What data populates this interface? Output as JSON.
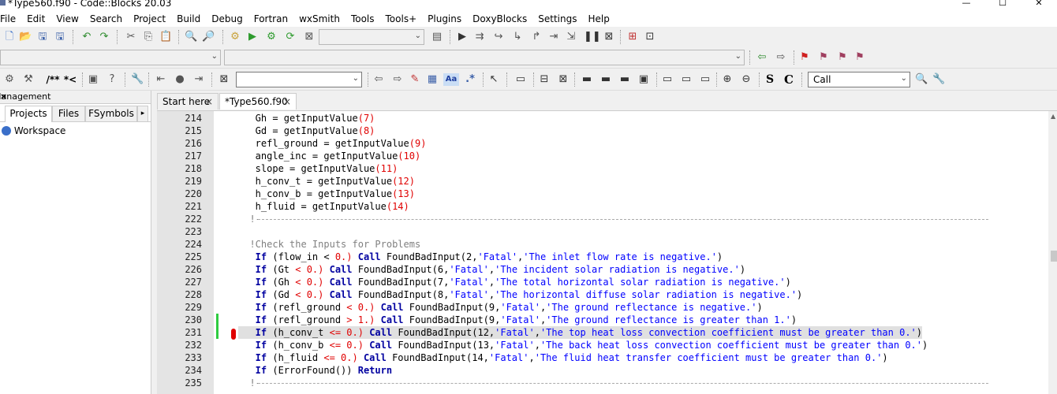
{
  "window": {
    "title": "*Type560.f90 - Code::Blocks 20.03"
  },
  "menu": [
    "File",
    "Edit",
    "View",
    "Search",
    "Project",
    "Build",
    "Debug",
    "Fortran",
    "wxSmith",
    "Tools",
    "Tools+",
    "Plugins",
    "DoxyBlocks",
    "Settings",
    "Help"
  ],
  "toolbar": {
    "build_target_value": "",
    "search_combo_value": "",
    "call_combo_value": "Call",
    "comment_labels": [
      "/**",
      "*<"
    ],
    "regex_label": ".*",
    "match_case_label": "Aa",
    "s_label": "S",
    "c_label": "C"
  },
  "management": {
    "title": "Management",
    "tabs": [
      "Projects",
      "Files",
      "FSymbols"
    ],
    "tree": [
      "Workspace"
    ]
  },
  "editor": {
    "tabs": [
      {
        "label": "Start here"
      },
      {
        "label": "*Type560.f90"
      }
    ],
    "lines": [
      {
        "n": "214",
        "code": [
          [
            "   Gh = getInputValue",
            ""
          ],
          [
            "(7)",
            "num-t"
          ]
        ]
      },
      {
        "n": "215",
        "code": [
          [
            "   Gd = getInputValue",
            ""
          ],
          [
            "(8)",
            "num-t"
          ]
        ]
      },
      {
        "n": "216",
        "code": [
          [
            "   refl_ground = getInputValue",
            ""
          ],
          [
            "(9)",
            "num-t"
          ]
        ]
      },
      {
        "n": "217",
        "code": [
          [
            "   angle_inc = getInputValue",
            ""
          ],
          [
            "(10)",
            "num-t"
          ]
        ]
      },
      {
        "n": "218",
        "code": [
          [
            "   slope = getInputValue",
            ""
          ],
          [
            "(11)",
            "num-t"
          ]
        ]
      },
      {
        "n": "219",
        "code": [
          [
            "   h_conv_t = getInputValue",
            ""
          ],
          [
            "(12)",
            "num-t"
          ]
        ]
      },
      {
        "n": "220",
        "code": [
          [
            "   h_conv_b = getInputValue",
            ""
          ],
          [
            "(13)",
            "num-t"
          ]
        ]
      },
      {
        "n": "221",
        "code": [
          [
            "   h_fluid = getInputValue",
            ""
          ],
          [
            "(14)",
            "num-t"
          ]
        ]
      },
      {
        "n": "222",
        "rule": true,
        "code": [
          [
            "  !-",
            "cm"
          ]
        ]
      },
      {
        "n": "223",
        "code": []
      },
      {
        "n": "224",
        "code": [
          [
            "  !Check the Inputs for Problems",
            "cm"
          ]
        ]
      },
      {
        "n": "225",
        "code": [
          [
            "   If",
            "kw"
          ],
          [
            " (flow_in ",
            ""
          ],
          [
            "<",
            ""
          ],
          [
            " 0.)",
            "num-t"
          ],
          [
            " Call",
            "kw"
          ],
          [
            " FoundBadInput(2,",
            ""
          ],
          [
            "'Fatal'",
            "str"
          ],
          [
            ",",
            ""
          ],
          [
            "'The inlet flow rate is negative.'",
            "str"
          ],
          [
            ")",
            ""
          ]
        ]
      },
      {
        "n": "226",
        "code": [
          [
            "   If",
            "kw"
          ],
          [
            " (Gt ",
            ""
          ],
          [
            "< 0.)",
            "num-t"
          ],
          [
            " Call",
            "kw"
          ],
          [
            " FoundBadInput(6,",
            ""
          ],
          [
            "'Fatal'",
            "str"
          ],
          [
            ",",
            ""
          ],
          [
            "'The incident solar radiation is negative.'",
            "str"
          ],
          [
            ")",
            ""
          ]
        ]
      },
      {
        "n": "227",
        "code": [
          [
            "   If",
            "kw"
          ],
          [
            " (Gh ",
            ""
          ],
          [
            "< 0.)",
            "num-t"
          ],
          [
            " Call",
            "kw"
          ],
          [
            " FoundBadInput(7,",
            ""
          ],
          [
            "'Fatal'",
            "str"
          ],
          [
            ",",
            ""
          ],
          [
            "'The total horizontal solar radiation is negative.'",
            "str"
          ],
          [
            ")",
            ""
          ]
        ]
      },
      {
        "n": "228",
        "code": [
          [
            "   If",
            "kw"
          ],
          [
            " (Gd ",
            ""
          ],
          [
            "< 0.)",
            "num-t"
          ],
          [
            " Call",
            "kw"
          ],
          [
            " FoundBadInput(8,",
            ""
          ],
          [
            "'Fatal'",
            "str"
          ],
          [
            ",",
            ""
          ],
          [
            "'The horizontal diffuse solar radiation is negative.'",
            "str"
          ],
          [
            ")",
            ""
          ]
        ]
      },
      {
        "n": "229",
        "code": [
          [
            "   If",
            "kw"
          ],
          [
            " (refl_ground ",
            ""
          ],
          [
            "< 0.)",
            "num-t"
          ],
          [
            " Call",
            "kw"
          ],
          [
            " FoundBadInput(9,",
            ""
          ],
          [
            "'Fatal'",
            "str"
          ],
          [
            ",",
            ""
          ],
          [
            "'The ground reflectance is negative.'",
            "str"
          ],
          [
            ")",
            ""
          ]
        ]
      },
      {
        "n": "230",
        "code": [
          [
            "   If",
            "kw"
          ],
          [
            " (refl_ground ",
            ""
          ],
          [
            "> 1.)",
            "num-t"
          ],
          [
            " Call",
            "kw"
          ],
          [
            " FoundBadInput(9,",
            ""
          ],
          [
            "'Fatal'",
            "str"
          ],
          [
            ",",
            ""
          ],
          [
            "'The ground reflectance is greater than 1.'",
            "str"
          ],
          [
            ")",
            ""
          ]
        ]
      },
      {
        "n": "231",
        "hl": true,
        "code": [
          [
            "   If",
            "kw"
          ],
          [
            " (h_conv_t ",
            ""
          ],
          [
            "<= 0.)",
            "num-t"
          ],
          [
            " Call",
            "kw"
          ],
          [
            " FoundBadInput(12,",
            ""
          ],
          [
            "'Fatal'",
            "str"
          ],
          [
            ",",
            ""
          ],
          [
            "'The top heat loss convection coefficient must be greater than 0.'",
            "str"
          ],
          [
            ")",
            ""
          ]
        ]
      },
      {
        "n": "232",
        "code": [
          [
            "   If",
            "kw"
          ],
          [
            " (h_conv_b ",
            ""
          ],
          [
            "<= 0.)",
            "num-t"
          ],
          [
            " Call",
            "kw"
          ],
          [
            " FoundBadInput(13,",
            ""
          ],
          [
            "'Fatal'",
            "str"
          ],
          [
            ",",
            ""
          ],
          [
            "'The back heat loss convection coefficient must be greater than 0.'",
            "str"
          ],
          [
            ")",
            ""
          ]
        ]
      },
      {
        "n": "233",
        "code": [
          [
            "   If",
            "kw"
          ],
          [
            " (h_fluid ",
            ""
          ],
          [
            "<= 0.)",
            "num-t"
          ],
          [
            " Call",
            "kw"
          ],
          [
            " FoundBadInput(14,",
            ""
          ],
          [
            "'Fatal'",
            "str"
          ],
          [
            ",",
            ""
          ],
          [
            "'The fluid heat transfer coefficient must be greater than 0.'",
            "str"
          ],
          [
            ")",
            ""
          ]
        ]
      },
      {
        "n": "234",
        "code": [
          [
            "   If",
            "kw"
          ],
          [
            " (ErrorFound()) ",
            ""
          ],
          [
            "Return",
            "kw"
          ]
        ]
      },
      {
        "n": "235",
        "rule": true,
        "code": [
          [
            "  !-",
            "cm"
          ]
        ]
      }
    ]
  },
  "colors": {
    "keyword": "#0000a0",
    "string": "#0000ff",
    "number": "#e00000",
    "comment": "#808080",
    "change_bar": "#2ecc40"
  },
  "icons": [
    "new-file-icon",
    "open-icon",
    "save-icon",
    "save-all-icon",
    "undo-icon",
    "redo-icon",
    "cut-icon",
    "copy-icon",
    "paste-icon",
    "find-icon",
    "replace-icon",
    "build-icon",
    "run-icon",
    "build-run-icon",
    "rebuild-icon",
    "abort-icon",
    "debug-icon",
    "stop-debug-icon",
    "bookmark-icon",
    "zoom-in-icon",
    "zoom-out-icon",
    "settings-icon"
  ]
}
